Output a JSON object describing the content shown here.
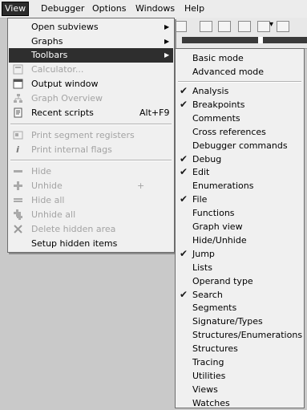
{
  "menubar": {
    "items": [
      "View",
      "Debugger",
      "Options",
      "Windows",
      "Help"
    ],
    "active": "View"
  },
  "view_menu": {
    "items": [
      {
        "label": "Open subviews",
        "submenu": true,
        "enabled": true,
        "icon": null
      },
      {
        "label": "Graphs",
        "submenu": true,
        "enabled": true,
        "icon": null
      },
      {
        "label": "Toolbars",
        "submenu": true,
        "enabled": true,
        "selected": true,
        "icon": null
      },
      {
        "label": "Calculator...",
        "enabled": false,
        "icon": "calculator-icon"
      },
      {
        "label": "Output window",
        "enabled": true,
        "icon": "output-window-icon"
      },
      {
        "label": "Graph Overview",
        "enabled": false,
        "icon": "graph-overview-icon"
      },
      {
        "label": "Recent scripts",
        "shortcut": "Alt+F9",
        "enabled": true,
        "icon": "recent-scripts-icon"
      },
      {
        "label": "Print segment registers",
        "enabled": false,
        "icon": "print-segment-registers-icon"
      },
      {
        "label": "Print internal flags",
        "enabled": false,
        "icon": "print-internal-flags-icon"
      },
      {
        "label": "Hide",
        "enabled": false,
        "icon": "hide-icon"
      },
      {
        "label": "Unhide",
        "enabled": false,
        "icon": "unhide-icon",
        "trailing": "+"
      },
      {
        "label": "Hide all",
        "enabled": false,
        "icon": "hide-all-icon"
      },
      {
        "label": "Unhide all",
        "enabled": false,
        "icon": "unhide-all-icon"
      },
      {
        "label": "Delete hidden area",
        "enabled": false,
        "icon": "delete-icon"
      },
      {
        "label": "Setup hidden items",
        "enabled": true,
        "icon": null
      }
    ]
  },
  "toolbars_menu": {
    "modes": [
      "Basic mode",
      "Advanced mode"
    ],
    "items": [
      {
        "label": "Analysis",
        "checked": true
      },
      {
        "label": "Breakpoints",
        "checked": true
      },
      {
        "label": "Comments",
        "checked": false
      },
      {
        "label": "Cross references",
        "checked": false
      },
      {
        "label": "Debugger commands",
        "checked": false
      },
      {
        "label": "Debug",
        "checked": true
      },
      {
        "label": "Edit",
        "checked": true
      },
      {
        "label": "Enumerations",
        "checked": false
      },
      {
        "label": "File",
        "checked": true
      },
      {
        "label": "Functions",
        "checked": false
      },
      {
        "label": "Graph view",
        "checked": false
      },
      {
        "label": "Hide/Unhide",
        "checked": false
      },
      {
        "label": "Jump",
        "checked": true
      },
      {
        "label": "Lists",
        "checked": false
      },
      {
        "label": "Operand type",
        "checked": false
      },
      {
        "label": "Search",
        "checked": true
      },
      {
        "label": "Segments",
        "checked": false
      },
      {
        "label": "Signature/Types",
        "checked": false
      },
      {
        "label": "Structures/Enumerations",
        "checked": false
      },
      {
        "label": "Structures",
        "checked": false
      },
      {
        "label": "Tracing",
        "checked": false
      },
      {
        "label": "Utilities",
        "checked": false
      },
      {
        "label": "Views",
        "checked": false
      },
      {
        "label": "Watches",
        "checked": false
      }
    ]
  },
  "glyphs": {
    "arrow": "▶",
    "check": "✔",
    "arrow_down": "▾"
  }
}
